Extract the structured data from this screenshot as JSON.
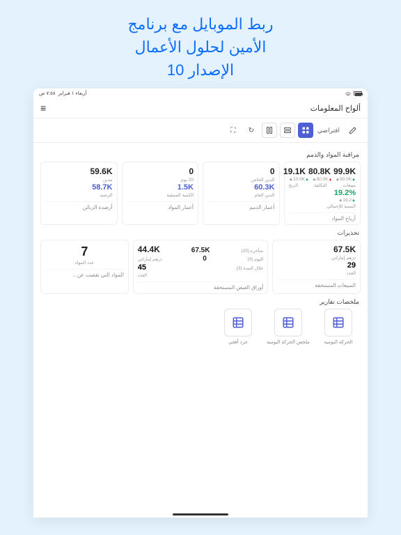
{
  "hero": {
    "line1": "ربط الموبايل مع برنامج",
    "line2": "الأمين لحلول الأعمال",
    "line3": "الإصدار 10"
  },
  "status": {
    "time": "٧:٥٨ ص",
    "date": "أربعاء ١ فبراير"
  },
  "header": {
    "title": "ألواح المعلومات"
  },
  "toolbar": {
    "default_label": "افتراضي"
  },
  "sections": {
    "monitoring": "مراقبة المواد والذمم",
    "warnings": "تحذيرات",
    "reports": "ملخصات تقارير"
  },
  "monitor": {
    "profits": {
      "val1": "99.9K",
      "delta1": "90.0K▲",
      "sub1": "مبيعات",
      "val2": "19.2%",
      "delta2": "19.2▲",
      "sub2": "النسبة للإجمالي",
      "caption": "أرباح المواد"
    },
    "balance": {
      "val1": "80.8K",
      "delta1": "80.0K▲",
      "sub1": "التكلفة",
      "val2": "19.1K",
      "delta2": "10.0K▲",
      "sub2": "الربح",
      "caption": ""
    },
    "debt_ages": {
      "val1": "0",
      "sub1": "الدين الخاص",
      "val2": "60.3K",
      "sub2": "الدين العام",
      "caption": "أعمار الذمم"
    },
    "material_ages": {
      "val1": "0",
      "sub1": "20 يوم",
      "val2": "1.5K",
      "sub2": "الكمية المتبقية",
      "caption": "أعمار المواد"
    },
    "client_balances": {
      "val1": "59.6K",
      "sub1": "مدين",
      "val2": "58.7K",
      "sub2": "الرصيد",
      "caption": "أرصدة الزبائن"
    }
  },
  "warn": {
    "receivables": {
      "val": "67.5K",
      "unit": "درهم إماراتي",
      "count": "29",
      "count_label": "العدد",
      "caption": "المبيعات المستحقة"
    },
    "checks": {
      "l1a": "متأخره (20)",
      "l1b": "67.5K",
      "l2a": "اليوم (0)",
      "l2b": "0",
      "l3a": "خلال المدة (3)",
      "l3b": "44.4K",
      "unit": "درهم إماراتي",
      "count": "45",
      "count_label": "العدد",
      "caption": "أوراق القبض المستحقة"
    },
    "low_stock": {
      "val": "7",
      "label": "عدد المواد",
      "caption": "المواد التي نقصت عن .."
    }
  },
  "reports": {
    "r1": "الحركة اليومية",
    "r2": "ملخص الحركة اليومية",
    "r3": "جرد أفقي"
  }
}
